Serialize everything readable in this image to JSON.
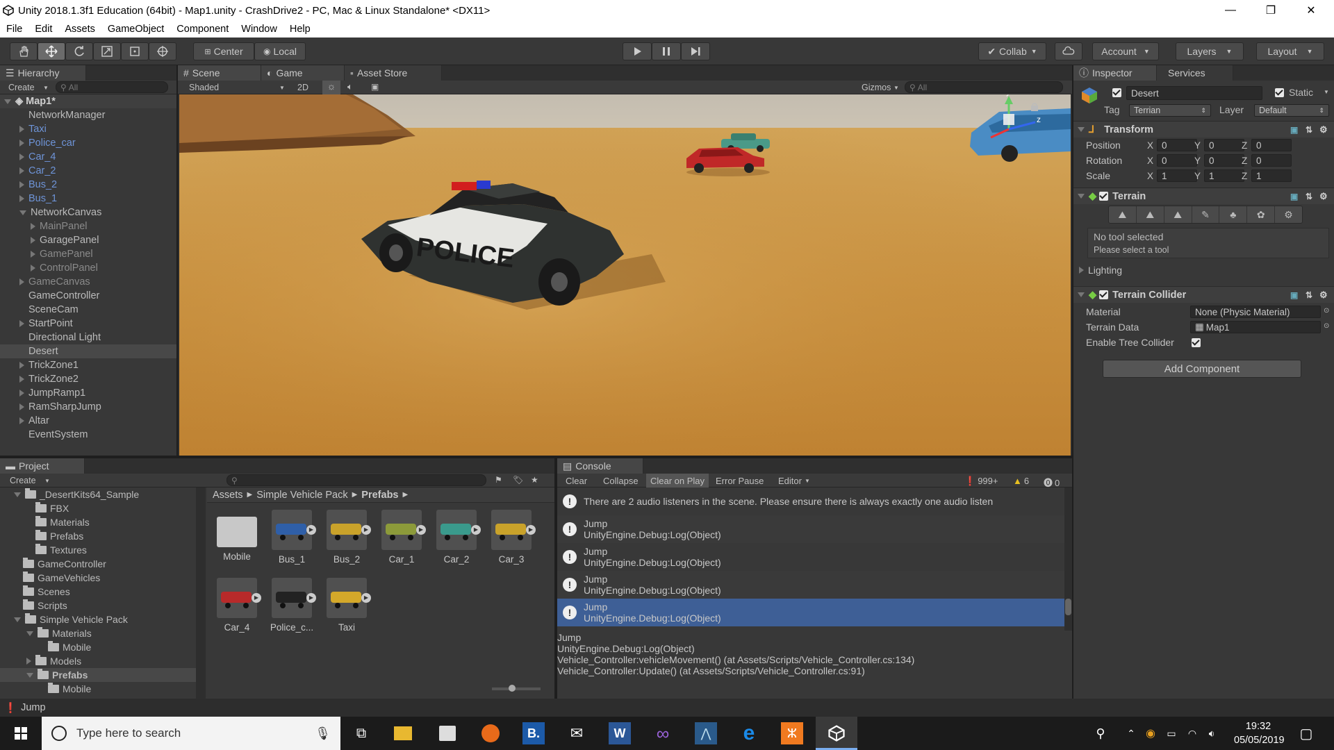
{
  "window": {
    "title": "Unity 2018.1.3f1 Education (64bit) - Map1.unity - CrashDrive2 - PC, Mac & Linux Standalone* <DX11>",
    "minimize": "—",
    "maximize": "❐",
    "close": "✕"
  },
  "menu": [
    "File",
    "Edit",
    "Assets",
    "GameObject",
    "Component",
    "Window",
    "Help"
  ],
  "toolbar": {
    "pivot": "Center",
    "space": "Local",
    "collab": "Collab",
    "account": "Account",
    "layers": "Layers",
    "layout": "Layout"
  },
  "hierarchy": {
    "tab": "Hierarchy",
    "create": "Create",
    "search_placeholder": "All",
    "scene_name": "Map1*",
    "items": [
      {
        "label": "NetworkManager",
        "style": "normal",
        "arrow": "none",
        "indent": 1
      },
      {
        "label": "Taxi",
        "style": "blue",
        "arrow": "closed",
        "indent": 1
      },
      {
        "label": "Police_car",
        "style": "blue",
        "arrow": "closed",
        "indent": 1
      },
      {
        "label": "Car_4",
        "style": "blue",
        "arrow": "closed",
        "indent": 1
      },
      {
        "label": "Car_2",
        "style": "blue",
        "arrow": "closed",
        "indent": 1
      },
      {
        "label": "Bus_2",
        "style": "blue",
        "arrow": "closed",
        "indent": 1
      },
      {
        "label": "Bus_1",
        "style": "blue",
        "arrow": "closed",
        "indent": 1
      },
      {
        "label": "NetworkCanvas",
        "style": "normal",
        "arrow": "open",
        "indent": 1
      },
      {
        "label": "MainPanel",
        "style": "dim",
        "arrow": "closed",
        "indent": 2
      },
      {
        "label": "GaragePanel",
        "style": "normal",
        "arrow": "closed",
        "indent": 2
      },
      {
        "label": "GamePanel",
        "style": "dim",
        "arrow": "closed",
        "indent": 2
      },
      {
        "label": "ControlPanel",
        "style": "dim",
        "arrow": "closed",
        "indent": 2
      },
      {
        "label": "GameCanvas",
        "style": "dim",
        "arrow": "closed",
        "indent": 1
      },
      {
        "label": "GameController",
        "style": "normal",
        "arrow": "none",
        "indent": 1
      },
      {
        "label": "SceneCam",
        "style": "normal",
        "arrow": "none",
        "indent": 1
      },
      {
        "label": "StartPoint",
        "style": "normal",
        "arrow": "closed",
        "indent": 1
      },
      {
        "label": "Directional Light",
        "style": "normal",
        "arrow": "none",
        "indent": 1
      },
      {
        "label": "Desert",
        "style": "selected",
        "arrow": "none",
        "indent": 1
      },
      {
        "label": "TrickZone1",
        "style": "normal",
        "arrow": "closed",
        "indent": 1
      },
      {
        "label": "TrickZone2",
        "style": "normal",
        "arrow": "closed",
        "indent": 1
      },
      {
        "label": "JumpRamp1",
        "style": "normal",
        "arrow": "closed",
        "indent": 1
      },
      {
        "label": "RamSharpJump",
        "style": "normal",
        "arrow": "closed",
        "indent": 1
      },
      {
        "label": "Altar",
        "style": "normal",
        "arrow": "closed",
        "indent": 1
      },
      {
        "label": "EventSystem",
        "style": "normal",
        "arrow": "none",
        "indent": 1
      }
    ]
  },
  "scene_view": {
    "tabs": [
      "Scene",
      "Game",
      "Asset Store"
    ],
    "shading": "Shaded",
    "mode_2d": "2D",
    "gizmos": "Gizmos",
    "search_placeholder": "All",
    "car_text": "POLICE",
    "gizmo_axis_y": "y",
    "gizmo_axis_z": "z"
  },
  "inspector": {
    "tabs": [
      "Inspector",
      "Services"
    ],
    "object_name": "Desert",
    "static_label": "Static",
    "tag_label": "Tag",
    "tag_value": "Terrian",
    "layer_label": "Layer",
    "layer_value": "Default",
    "transform": {
      "title": "Transform",
      "rows": [
        {
          "label": "Position",
          "x": "0",
          "y": "0",
          "z": "0"
        },
        {
          "label": "Rotation",
          "x": "0",
          "y": "0",
          "z": "0"
        },
        {
          "label": "Scale",
          "x": "1",
          "y": "1",
          "z": "1"
        }
      ]
    },
    "terrain": {
      "title": "Terrain",
      "msg1": "No tool selected",
      "msg2": "Please select a tool",
      "lighting": "Lighting"
    },
    "collider": {
      "title": "Terrain Collider",
      "material_label": "Material",
      "material_value": "None (Physic Material)",
      "data_label": "Terrain Data",
      "data_value": "Map1",
      "tree_label": "Enable Tree Collider"
    },
    "add_component": "Add Component"
  },
  "project": {
    "tab": "Project",
    "create": "Create",
    "tree": [
      {
        "label": "_DesertKits64_Sample",
        "indent": 1,
        "arrow": "open"
      },
      {
        "label": "FBX",
        "indent": 2,
        "arrow": "none"
      },
      {
        "label": "Materials",
        "indent": 2,
        "arrow": "none"
      },
      {
        "label": "Prefabs",
        "indent": 2,
        "arrow": "none"
      },
      {
        "label": "Textures",
        "indent": 2,
        "arrow": "none"
      },
      {
        "label": "GameController",
        "indent": 1,
        "arrow": "none"
      },
      {
        "label": "GameVehicles",
        "indent": 1,
        "arrow": "none"
      },
      {
        "label": "Scenes",
        "indent": 1,
        "arrow": "none"
      },
      {
        "label": "Scripts",
        "indent": 1,
        "arrow": "none"
      },
      {
        "label": "Simple Vehicle Pack",
        "indent": 1,
        "arrow": "open"
      },
      {
        "label": "Materials",
        "indent": 2,
        "arrow": "open"
      },
      {
        "label": "Mobile",
        "indent": 3,
        "arrow": "none"
      },
      {
        "label": "Models",
        "indent": 2,
        "arrow": "closed"
      },
      {
        "label": "Prefabs",
        "indent": 2,
        "arrow": "open",
        "selected": true
      },
      {
        "label": "Mobile",
        "indent": 3,
        "arrow": "none"
      }
    ],
    "breadcrumb": [
      "Assets",
      "Simple Vehicle Pack",
      "Prefabs"
    ],
    "assets": [
      {
        "label": "Mobile",
        "color": "folder"
      },
      {
        "label": "Bus_1",
        "color": "#2f5fa8"
      },
      {
        "label": "Bus_2",
        "color": "#c9a22a"
      },
      {
        "label": "Car_1",
        "color": "#8c9a3a"
      },
      {
        "label": "Car_2",
        "color": "#3a9a8c"
      },
      {
        "label": "Car_3",
        "color": "#c9a22a"
      },
      {
        "label": "Car_4",
        "color": "#b82a2a"
      },
      {
        "label": "Police_c...",
        "color": "#222222"
      },
      {
        "label": "Taxi",
        "color": "#d4a82a"
      }
    ]
  },
  "console": {
    "tab": "Console",
    "buttons": [
      "Clear",
      "Collapse",
      "Clear on Play",
      "Error Pause",
      "Editor"
    ],
    "count_log": "999+",
    "count_warn": "6",
    "count_err": "0",
    "rows": [
      {
        "l1": "There are 2 audio listeners in the scene. Please ensure there is always exactly one audio listen",
        "l2": "",
        "selected": false
      },
      {
        "l1": "Jump",
        "l2": "UnityEngine.Debug:Log(Object)",
        "selected": false
      },
      {
        "l1": "Jump",
        "l2": "UnityEngine.Debug:Log(Object)",
        "selected": false
      },
      {
        "l1": "Jump",
        "l2": "UnityEngine.Debug:Log(Object)",
        "selected": false
      },
      {
        "l1": "Jump",
        "l2": "UnityEngine.Debug:Log(Object)",
        "selected": true
      }
    ],
    "detail": [
      "Jump",
      "UnityEngine.Debug:Log(Object)",
      "Vehicle_Controller:vehicleMovement() (at Assets/Scripts/Vehicle_Controller.cs:134)",
      "Vehicle_Controller:Update() (at Assets/Scripts/Vehicle_Controller.cs:91)"
    ]
  },
  "status": {
    "text": "Jump"
  },
  "taskbar": {
    "search_placeholder": "Type here to search",
    "time": "19:32",
    "date": "05/05/2019"
  }
}
